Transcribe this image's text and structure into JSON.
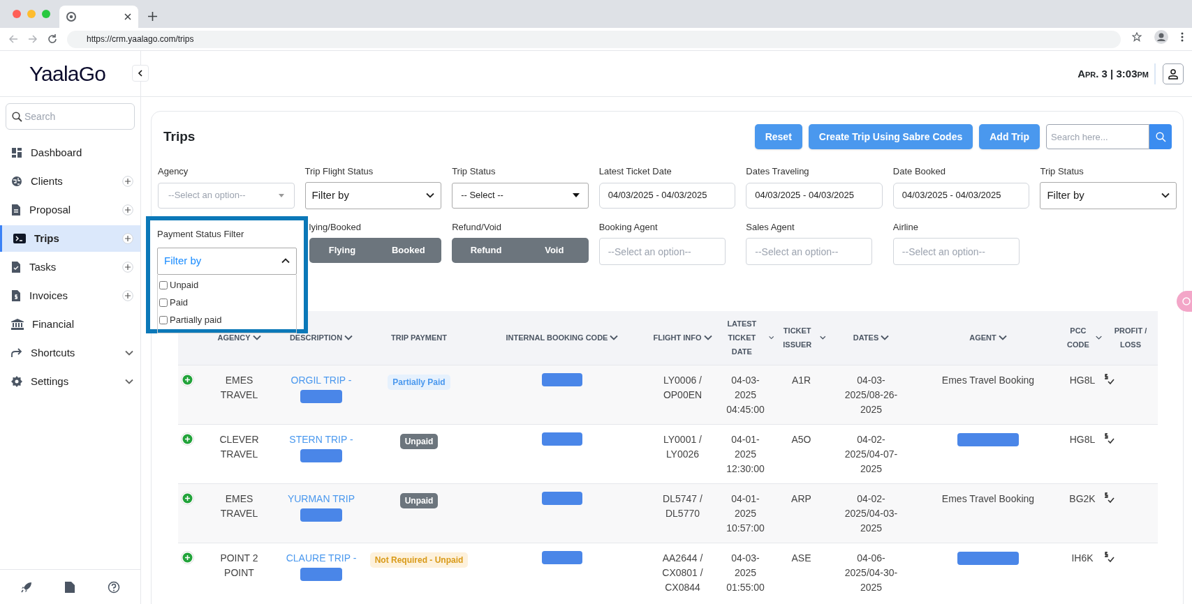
{
  "browser": {
    "url": "https://crm.yaalago.com/trips"
  },
  "header": {
    "logo": "YaalaGo",
    "datetime": "Apr. 3 | 3:03pm"
  },
  "sidebar": {
    "search_placeholder": "Search",
    "items": [
      {
        "label": "Dashboard",
        "selected": false,
        "kind": "plain"
      },
      {
        "label": "Clients",
        "selected": false,
        "kind": "add"
      },
      {
        "label": "Proposal",
        "selected": false,
        "kind": "add"
      },
      {
        "label": "Trips",
        "selected": true,
        "kind": "add"
      },
      {
        "label": "Tasks",
        "selected": false,
        "kind": "add"
      },
      {
        "label": "Invoices",
        "selected": false,
        "kind": "add"
      },
      {
        "label": "Financial",
        "selected": false,
        "kind": "plain"
      },
      {
        "label": "Shortcuts",
        "selected": false,
        "kind": "expand"
      },
      {
        "label": "Settings",
        "selected": false,
        "kind": "expand"
      }
    ]
  },
  "page": {
    "title": "Trips",
    "buttons": [
      "Reset",
      "Create Trip Using Sabre Codes",
      "Add Trip"
    ],
    "search_placeholder": "Search here..."
  },
  "filters_row1": [
    {
      "label": "Agency",
      "kind": "combo",
      "placeholder": "--Select an option--"
    },
    {
      "label": "Trip Flight Status",
      "kind": "select",
      "value": "Filter by"
    },
    {
      "label": "Trip Status",
      "kind": "native",
      "value": "-- Select --"
    },
    {
      "label": "Latest Ticket Date",
      "kind": "date",
      "value": "04/03/2025 - 04/03/2025"
    },
    {
      "label": "Dates Traveling",
      "kind": "date",
      "value": "04/03/2025 - 04/03/2025"
    },
    {
      "label": "Date Booked",
      "kind": "date",
      "value": "04/03/2025 - 04/03/2025"
    },
    {
      "label": "Trip Status",
      "kind": "select",
      "value": "Filter by"
    }
  ],
  "filters_row2": [
    {
      "label": "lying/Booked",
      "kind": "toggle",
      "options": [
        "Flying",
        "Booked"
      ]
    },
    {
      "label": "Refund/Void",
      "kind": "toggle",
      "options": [
        "Refund",
        "Void"
      ]
    },
    {
      "label": "Booking Agent",
      "kind": "input",
      "placeholder": "--Select an option--"
    },
    {
      "label": "Sales Agent",
      "kind": "input",
      "placeholder": "--Select an option--"
    },
    {
      "label": "Airline",
      "kind": "input",
      "placeholder": "--Select an option--"
    }
  ],
  "payment_filter": {
    "label": "Payment Status Filter",
    "value": "Filter by",
    "expanded": true,
    "options": [
      {
        "label": "Unpaid",
        "checked": false
      },
      {
        "label": "Paid",
        "checked": false
      },
      {
        "label": "Partially paid",
        "checked": false
      }
    ]
  },
  "table": {
    "columns": [
      {
        "label": "AGENCY",
        "sortable": true
      },
      {
        "label": "DESCRIPTION",
        "sortable": true
      },
      {
        "label": "TRIP PAYMENT",
        "sortable": false
      },
      {
        "label": "INTERNAL BOOKING CODE",
        "sortable": true
      },
      {
        "label": "FLIGHT INFO",
        "sortable": true
      },
      {
        "label": "LATEST TICKET DATE",
        "sortable": true
      },
      {
        "label": "TICKET ISSUER",
        "sortable": true
      },
      {
        "label": "DATES",
        "sortable": true
      },
      {
        "label": "AGENT",
        "sortable": true
      },
      {
        "label": "PCC CODE",
        "sortable": true
      },
      {
        "label": "PROFIT / LOSS",
        "sortable": false
      }
    ],
    "rows": [
      {
        "agency": "EMES TRAVEL",
        "description": "ORGIL TRIP -",
        "payment": {
          "text": "Partially Paid",
          "kind": "partial"
        },
        "flight_info": "LY0006 / OP00EN",
        "latest_ticket_date": "04-03-2025 04:45:00",
        "ticket_issuer": "A1R",
        "dates": "04-03-2025/08-26-2025",
        "agent": "Emes Travel Booking",
        "agent_redacted": false,
        "pcc_code": "HG8L"
      },
      {
        "agency": "CLEVER TRAVEL",
        "description": "STERN TRIP -",
        "payment": {
          "text": "Unpaid",
          "kind": "unpaid"
        },
        "flight_info": "LY0001 / LY0026",
        "latest_ticket_date": "04-01-2025 12:30:00",
        "ticket_issuer": "A5O",
        "dates": "04-02-2025/04-07-2025",
        "agent_redacted": true,
        "pcc_code": "HG8L"
      },
      {
        "agency": "EMES TRAVEL",
        "description": "YURMAN TRIP",
        "payment": {
          "text": "Unpaid",
          "kind": "unpaid"
        },
        "flight_info": "DL5747 / DL5770",
        "latest_ticket_date": "04-01-2025 10:57:00",
        "ticket_issuer": "ARP",
        "dates": "04-02-2025/04-03-2025",
        "agent": "Emes Travel Booking",
        "agent_redacted": false,
        "pcc_code": "BG2K"
      },
      {
        "agency": "POINT 2 POINT",
        "description": "CLAURE TRIP -",
        "payment": {
          "text": "Not Required - Unpaid",
          "kind": "not_required"
        },
        "flight_info": "AA2644 / CX0801 / CX0844",
        "latest_ticket_date": "04-03-2025 01:55:00",
        "ticket_issuer": "ASE",
        "dates": "04-06-2025/04-30-2025",
        "agent_redacted": true,
        "pcc_code": "IH6K"
      }
    ]
  }
}
